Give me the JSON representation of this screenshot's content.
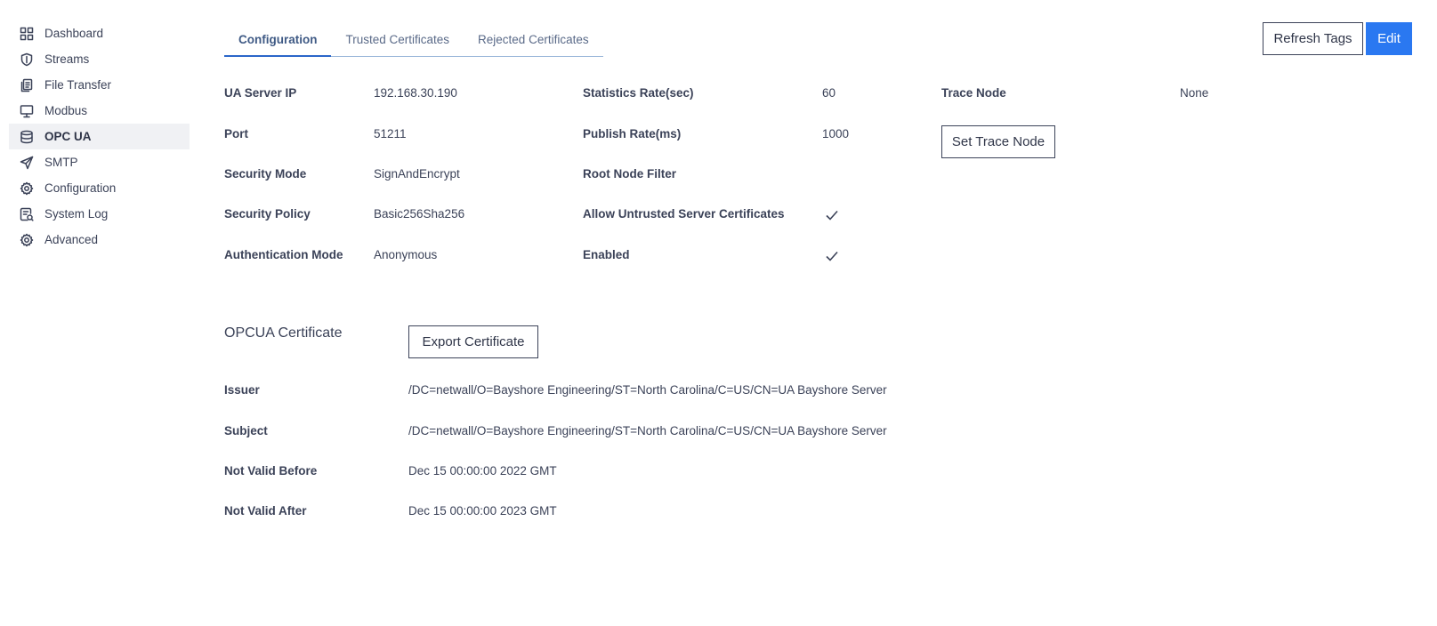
{
  "sidebar": {
    "items": [
      {
        "label": "Dashboard",
        "icon": "dashboard-icon"
      },
      {
        "label": "Streams",
        "icon": "shield-icon"
      },
      {
        "label": "File Transfer",
        "icon": "files-icon"
      },
      {
        "label": "Modbus",
        "icon": "monitor-icon"
      },
      {
        "label": "OPC UA",
        "icon": "database-icon",
        "active": true
      },
      {
        "label": "SMTP",
        "icon": "send-icon"
      },
      {
        "label": "Configuration",
        "icon": "gear-icon"
      },
      {
        "label": "System Log",
        "icon": "log-icon"
      },
      {
        "label": "Advanced",
        "icon": "gear-icon"
      }
    ]
  },
  "tabs": [
    {
      "label": "Configuration",
      "active": true
    },
    {
      "label": "Trusted Certificates"
    },
    {
      "label": "Rejected Certificates"
    }
  ],
  "actions": {
    "refresh_label": "Refresh Tags",
    "edit_label": "Edit",
    "trace_label": "Set Trace Node",
    "export_label": "Export Certificate"
  },
  "config": {
    "ua_server_ip": {
      "label": "UA Server IP",
      "value": "192.168.30.190"
    },
    "port": {
      "label": "Port",
      "value": "51211"
    },
    "security_mode": {
      "label": "Security Mode",
      "value": "SignAndEncrypt"
    },
    "security_policy": {
      "label": "Security Policy",
      "value": "Basic256Sha256"
    },
    "auth_mode": {
      "label": "Authentication Mode",
      "value": "Anonymous"
    },
    "statistics_rate": {
      "label": "Statistics Rate(sec)",
      "value": "60"
    },
    "publish_rate": {
      "label": "Publish Rate(ms)",
      "value": "1000"
    },
    "root_node_filter": {
      "label": "Root Node Filter",
      "value": ""
    },
    "allow_untrusted": {
      "label": "Allow Untrusted Server Certificates",
      "checked": true
    },
    "enabled": {
      "label": "Enabled",
      "checked": true
    },
    "trace_node": {
      "label": "Trace Node",
      "value": "None"
    }
  },
  "certificate": {
    "title": "OPCUA Certificate",
    "issuer": {
      "label": "Issuer",
      "value": "/DC=netwall/O=Bayshore Engineering/ST=North Carolina/C=US/CN=UA Bayshore Server"
    },
    "subject": {
      "label": "Subject",
      "value": "/DC=netwall/O=Bayshore Engineering/ST=North Carolina/C=US/CN=UA Bayshore Server"
    },
    "not_before": {
      "label": "Not Valid Before",
      "value": "Dec 15 00:00:00 2022 GMT"
    },
    "not_after": {
      "label": "Not Valid After",
      "value": "Dec 15 00:00:00 2023 GMT"
    }
  },
  "colors": {
    "accent": "#2a78f1",
    "text": "#3b4258",
    "active_bg": "#f0f1f4"
  }
}
